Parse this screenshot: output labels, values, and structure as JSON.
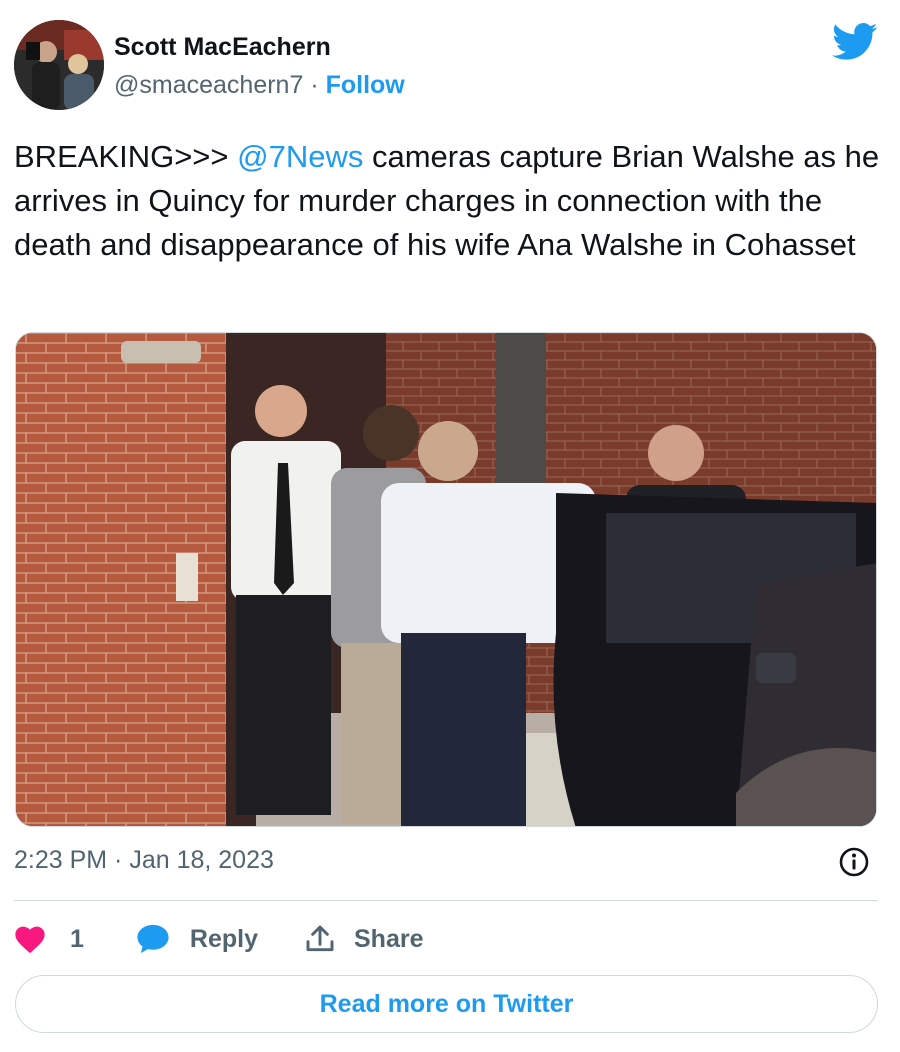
{
  "author": {
    "name": "Scott MacEachern",
    "handle": "@smaceachern7",
    "separator": "·",
    "follow_label": "Follow"
  },
  "tweet": {
    "text_prefix": "BREAKING>>> ",
    "mention": "@7News",
    "text_suffix": " cameras capture Brian Walshe as he arrives in Quincy for murder charges in connection with the death and disappearance of his wife Ana Walshe in Cohasset"
  },
  "timestamp": "2:23 PM · Jan 18, 2023",
  "actions": {
    "like_count": "1",
    "reply_label": "Reply",
    "share_label": "Share"
  },
  "read_more_label": "Read more on Twitter",
  "icons": {
    "brand": "twitter-bird-icon",
    "info": "info-icon",
    "like": "heart-icon",
    "reply": "speech-bubble-icon",
    "share": "share-upload-icon"
  },
  "colors": {
    "accent": "#1d9bf0",
    "like": "#f91880",
    "text": "#0f1419",
    "muted": "#536471",
    "border": "#cfd9de"
  }
}
